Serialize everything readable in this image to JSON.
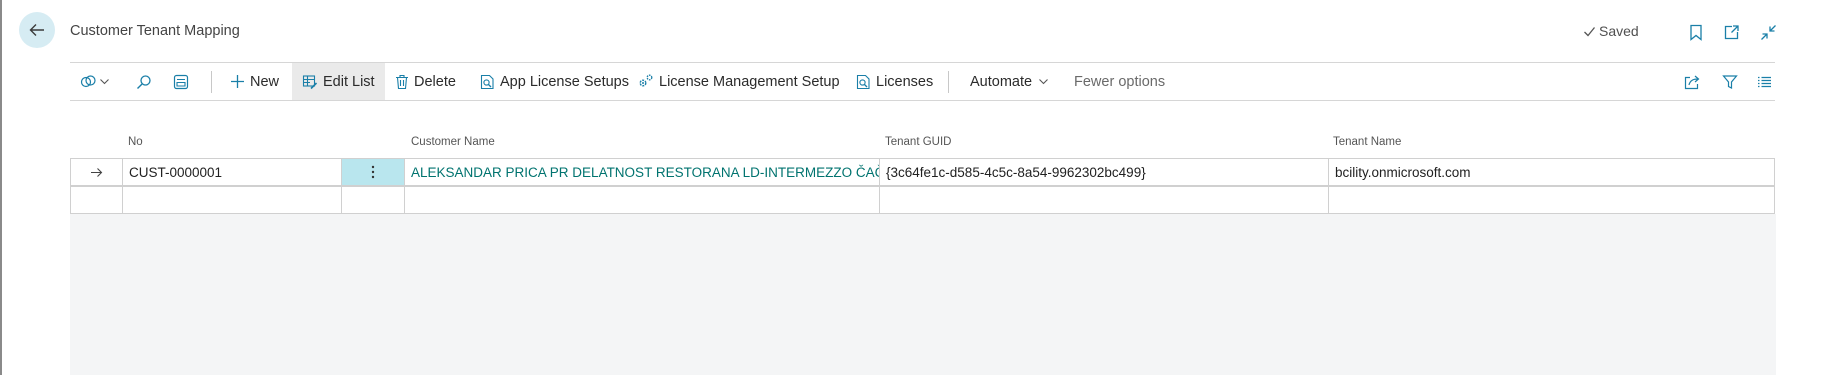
{
  "header": {
    "title": "Customer Tenant Mapping",
    "saved_label": "Saved"
  },
  "toolbar": {
    "new_label": "New",
    "edit_list_label": "Edit List",
    "delete_label": "Delete",
    "app_license_setups_label": "App License Setups",
    "license_management_setup_label": "License Management Setup",
    "licenses_label": "Licenses",
    "automate_label": "Automate",
    "fewer_options_label": "Fewer options"
  },
  "table": {
    "columns": {
      "no": "No",
      "customer_name": "Customer Name",
      "tenant_guid": "Tenant GUID",
      "tenant_name": "Tenant Name"
    },
    "rows": [
      {
        "no": "CUST-0000001",
        "customer_name": "ALEKSANDAR PRICA PR DELATNOST RESTORANA LD-INTERMEZZO ČAČAK",
        "tenant_guid": "{3c64fe1c-d585-4c5c-8a54-9962302bc499}",
        "tenant_name": "bcility.onmicrosoft.com"
      },
      {
        "no": "",
        "customer_name": "",
        "tenant_guid": "",
        "tenant_name": ""
      }
    ]
  },
  "colors": {
    "accent": "#00736f",
    "selected_cell": "#b9e6ee",
    "back_button": "#d6ecf3"
  },
  "icons": [
    "back-arrow-icon",
    "checkmark-icon",
    "bookmark-icon",
    "open-new-window-icon",
    "collapse-icon",
    "copilot-icon",
    "search-icon",
    "view-layout-icon",
    "plus-icon",
    "edit-list-icon",
    "trash-icon",
    "search-document-icon",
    "gear-icon",
    "chevron-down-icon",
    "share-icon",
    "filter-icon",
    "list-icon",
    "row-arrow-icon",
    "more-vertical-icon"
  ]
}
